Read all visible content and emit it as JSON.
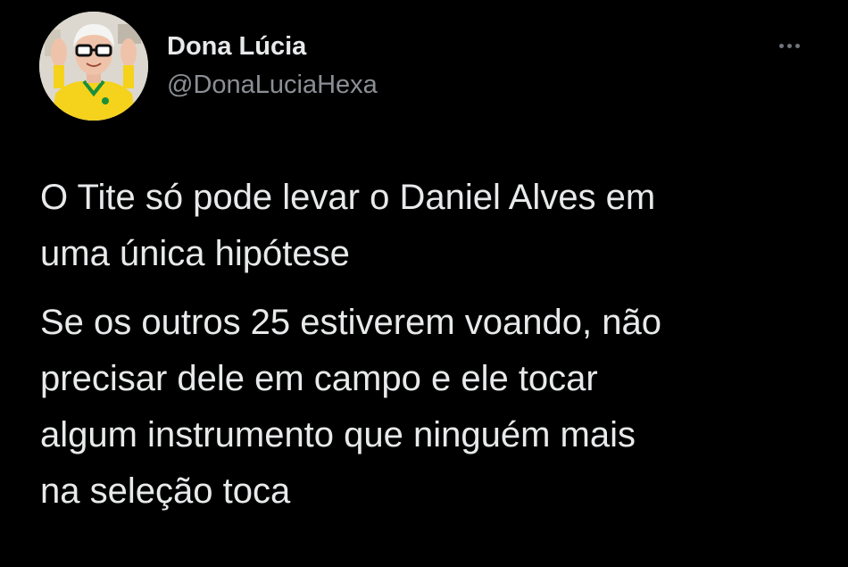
{
  "tweet": {
    "author": {
      "display_name": "Dona Lúcia",
      "handle": "@DonaLuciaHexa",
      "avatar_icon": "avatar-photo"
    },
    "more_icon": "more-horizontal-icon",
    "paragraphs": [
      {
        "lines": [
          "O Tite só pode levar o Daniel Alves em",
          "uma única hipótese"
        ]
      },
      {
        "lines": [
          "Se os outros 25 estiverem voando, não",
          "precisar dele em campo e ele tocar",
          "algum instrumento que ninguém mais",
          "na seleção toca"
        ]
      }
    ]
  },
  "colors": {
    "background": "#000000",
    "primary_text": "#e7e9ea",
    "secondary_text": "#8b8f94",
    "jersey_yellow": "#f5d21c",
    "jersey_green": "#1a8f3a"
  }
}
